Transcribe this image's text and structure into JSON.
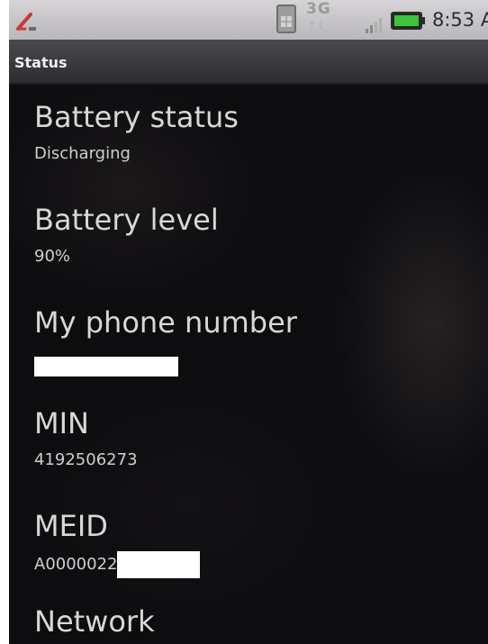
{
  "status_bar": {
    "network_type": "3G",
    "time": "8:53 A",
    "icons": [
      "missed-call-icon",
      "sim-icon",
      "data-arrows-icon",
      "signal-icon",
      "battery-icon"
    ]
  },
  "title": "Status",
  "items": [
    {
      "title": "Battery status",
      "value": "Discharging"
    },
    {
      "title": "Battery level",
      "value": "90%"
    },
    {
      "title": "My phone number",
      "value": ""
    },
    {
      "title": "MIN",
      "value": "4192506273"
    },
    {
      "title": "MEID",
      "value": "A0000022"
    },
    {
      "title": "Network",
      "value": ""
    }
  ],
  "colors": {
    "background": "#0d0c0f",
    "status_bar": "#c8c6c9",
    "title_bar": "#3a3a3e",
    "text_primary": "#d8d8d8",
    "battery": "#3fc23c"
  }
}
